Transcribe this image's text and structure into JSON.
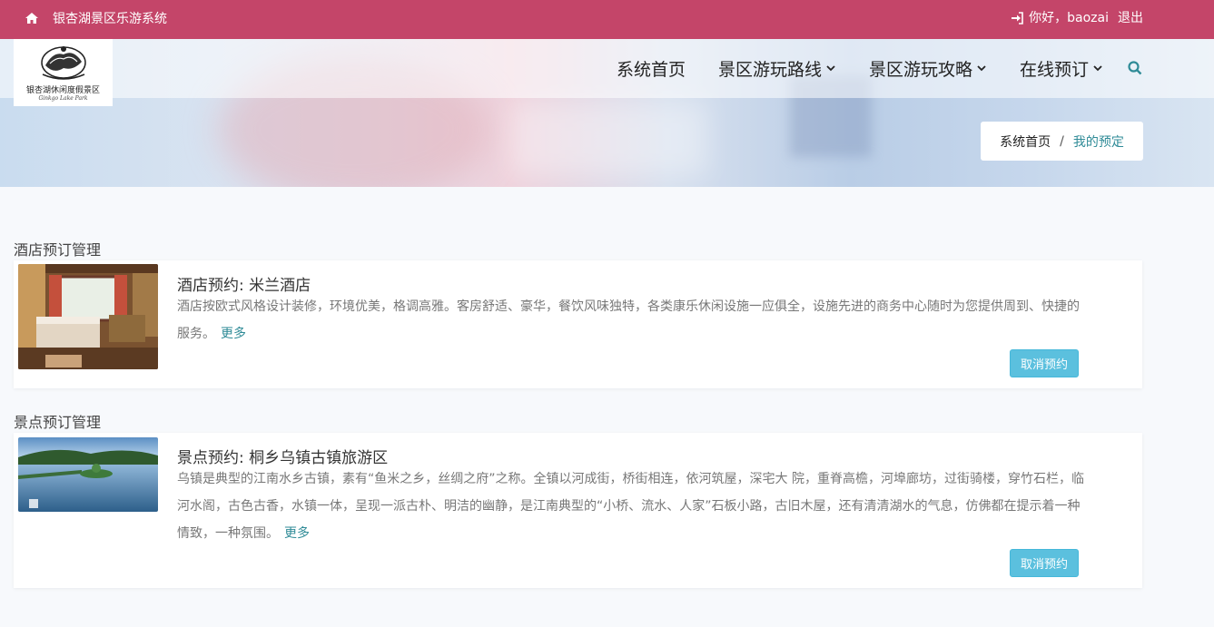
{
  "topbar": {
    "site_name": "银杏湖景区乐游系统",
    "greeting": "你好，baozai",
    "logout": "退出",
    "icons": [
      "home-icon",
      "sign-in-icon"
    ]
  },
  "logo": {
    "text": "银杏湖休闲度假景区",
    "sub": "Ginkgo Lake Park"
  },
  "nav": {
    "items": [
      {
        "label": "系统首页"
      },
      {
        "label": "景区游玩路线",
        "dropdown": true
      },
      {
        "label": "景区游玩攻略",
        "dropdown": true
      },
      {
        "label": "在线预订",
        "dropdown": true
      }
    ],
    "search_icon": "search-icon",
    "accent": "#2f8b97"
  },
  "breadcrumb": {
    "home": "系统首页",
    "separator": "/",
    "current": "我的预定"
  },
  "hotel_section": {
    "title": "酒店预订管理",
    "card": {
      "title": "酒店预约: 米兰酒店",
      "desc": "酒店按欧式风格设计装修，环境优美，格调高雅。客房舒适、豪华，餐饮风味独特，各类康乐休闲设施一应俱全，设施先进的商务中心随时为您提供周到、快捷的服务。",
      "more": "更多",
      "cancel": "取消预约"
    }
  },
  "scenic_section": {
    "title": "景点预订管理",
    "card": {
      "title": "景点预约: 桐乡乌镇古镇旅游区",
      "desc": "乌镇是典型的江南水乡古镇，素有“鱼米之乡，丝绸之府”之称。全镇以河成街，桥街相连，依河筑屋，深宅大 院，重脊高檐，河埠廊坊，过街骑楼，穿竹石栏，临河水阁，古色古香，水镇一体，呈现一派古朴、明洁的幽静，是江南典型的“小桥、流水、人家”石板小路，古旧木屋，还有清清湖水的气息，仿佛都在提示着一种情致，一种氛围。",
      "more": "更多",
      "cancel": "取消预约"
    }
  },
  "colors": {
    "topbar": "#c44569",
    "button": "#5bc0de",
    "link": "#2f8b97"
  }
}
